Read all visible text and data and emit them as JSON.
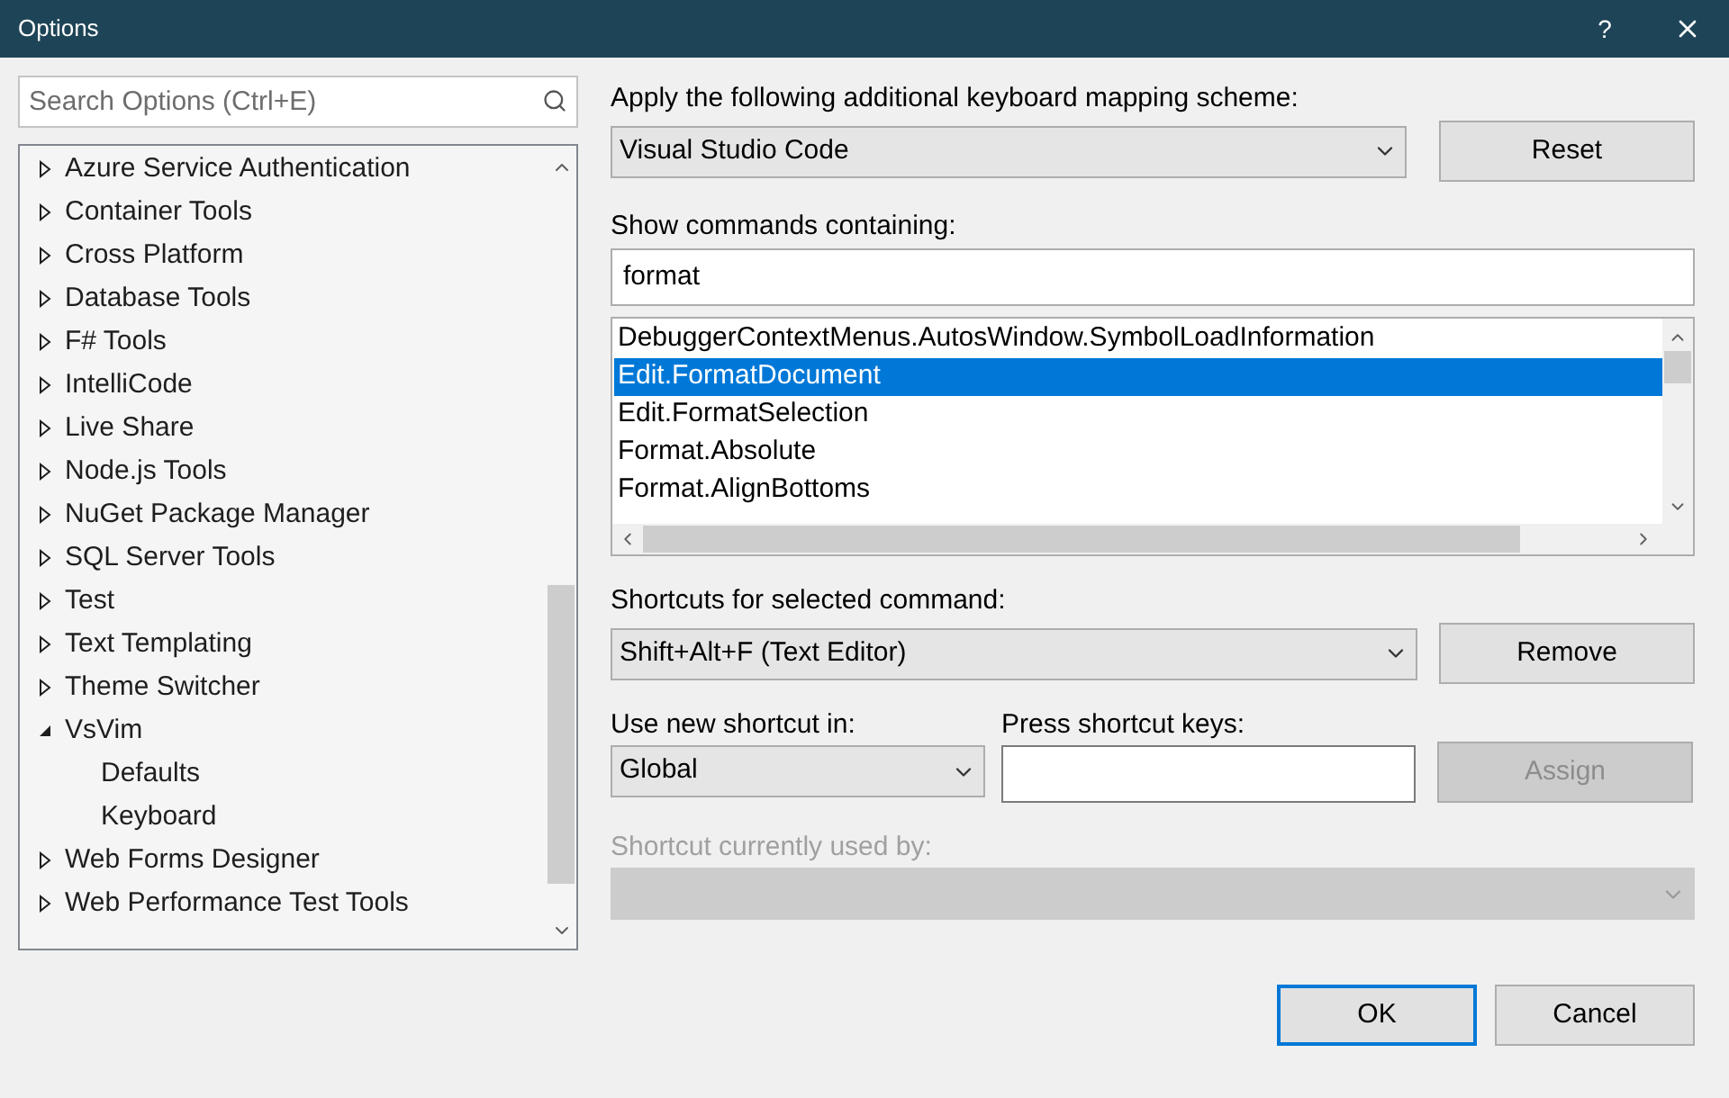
{
  "window": {
    "title": "Options",
    "help": "?"
  },
  "search": {
    "placeholder": "Search Options (Ctrl+E)"
  },
  "tree": {
    "items": [
      {
        "label": "Azure Service Authentication",
        "expanded": false
      },
      {
        "label": "Container Tools",
        "expanded": false
      },
      {
        "label": "Cross Platform",
        "expanded": false
      },
      {
        "label": "Database Tools",
        "expanded": false
      },
      {
        "label": "F# Tools",
        "expanded": false
      },
      {
        "label": "IntelliCode",
        "expanded": false
      },
      {
        "label": "Live Share",
        "expanded": false
      },
      {
        "label": "Node.js Tools",
        "expanded": false
      },
      {
        "label": "NuGet Package Manager",
        "expanded": false
      },
      {
        "label": "SQL Server Tools",
        "expanded": false
      },
      {
        "label": "Test",
        "expanded": false
      },
      {
        "label": "Text Templating",
        "expanded": false
      },
      {
        "label": "Theme Switcher",
        "expanded": false
      },
      {
        "label": "VsVim",
        "expanded": true,
        "children": [
          {
            "label": "Defaults"
          },
          {
            "label": "Keyboard"
          }
        ]
      },
      {
        "label": "Web Forms Designer",
        "expanded": false
      },
      {
        "label": "Web Performance Test Tools",
        "expanded": false
      }
    ]
  },
  "mapping_scheme": {
    "label": "Apply the following additional keyboard mapping scheme:",
    "value": "Visual Studio Code"
  },
  "reset_button": {
    "label": "Reset"
  },
  "commands_filter": {
    "label": "Show commands containing:",
    "value": "format"
  },
  "command_list": {
    "items": [
      {
        "label": "DebuggerContextMenus.AutosWindow.SymbolLoadInformation",
        "selected": false
      },
      {
        "label": "Edit.FormatDocument",
        "selected": true
      },
      {
        "label": "Edit.FormatSelection",
        "selected": false
      },
      {
        "label": "Format.Absolute",
        "selected": false
      },
      {
        "label": "Format.AlignBottoms",
        "selected": false
      }
    ]
  },
  "shortcuts": {
    "label": "Shortcuts for selected command:",
    "value": "Shift+Alt+F (Text Editor)"
  },
  "remove_button": {
    "label": "Remove",
    "disabled": false
  },
  "use_in": {
    "label": "Use new shortcut in:",
    "value": "Global"
  },
  "press_keys": {
    "label": "Press shortcut keys:"
  },
  "assign_button": {
    "label": "Assign",
    "disabled": true
  },
  "used_by": {
    "label": "Shortcut currently used by:",
    "disabled": true
  },
  "footer_buttons": [
    {
      "label": "OK",
      "default": true
    },
    {
      "label": "Cancel",
      "default": false
    }
  ]
}
